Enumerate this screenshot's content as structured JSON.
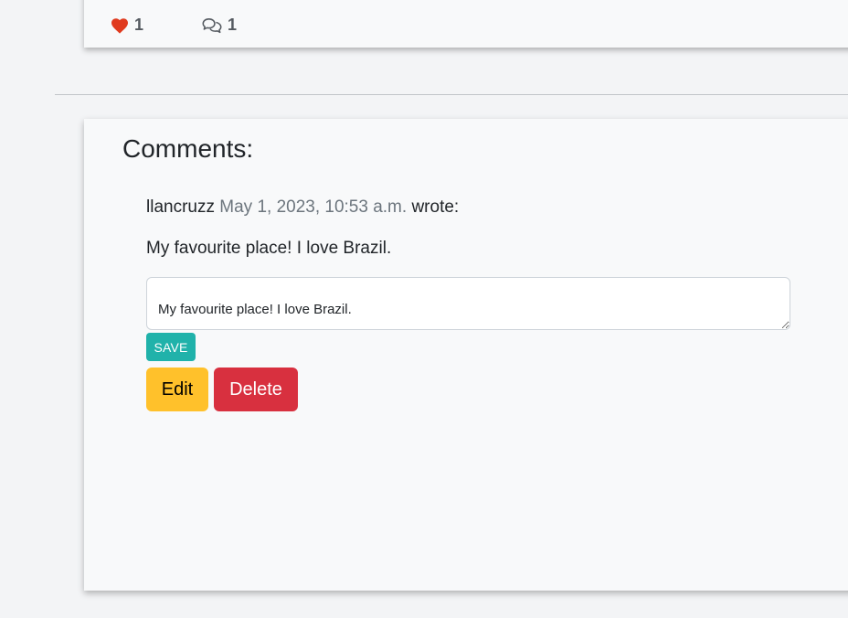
{
  "post": {
    "likes_count": "1",
    "comments_count": "1",
    "like_color": "#e03a1e",
    "like_icon": "heart-icon",
    "comments_icon": "speech-bubbles-icon"
  },
  "comments_section": {
    "heading": "Comments:",
    "comment": {
      "author": "llancruzz",
      "date": "May 1, 2023, 10:53 a.m.",
      "wrote_label": "wrote:",
      "body": "My favourite place! I love Brazil.",
      "edit_value": "My favourite place! I love Brazil."
    },
    "buttons": {
      "save_label": "SAVE",
      "edit_label": "Edit",
      "delete_label": "Delete"
    },
    "colors": {
      "save": "#20b2aa",
      "edit": "#ffc12b",
      "delete": "#d8303f"
    }
  }
}
